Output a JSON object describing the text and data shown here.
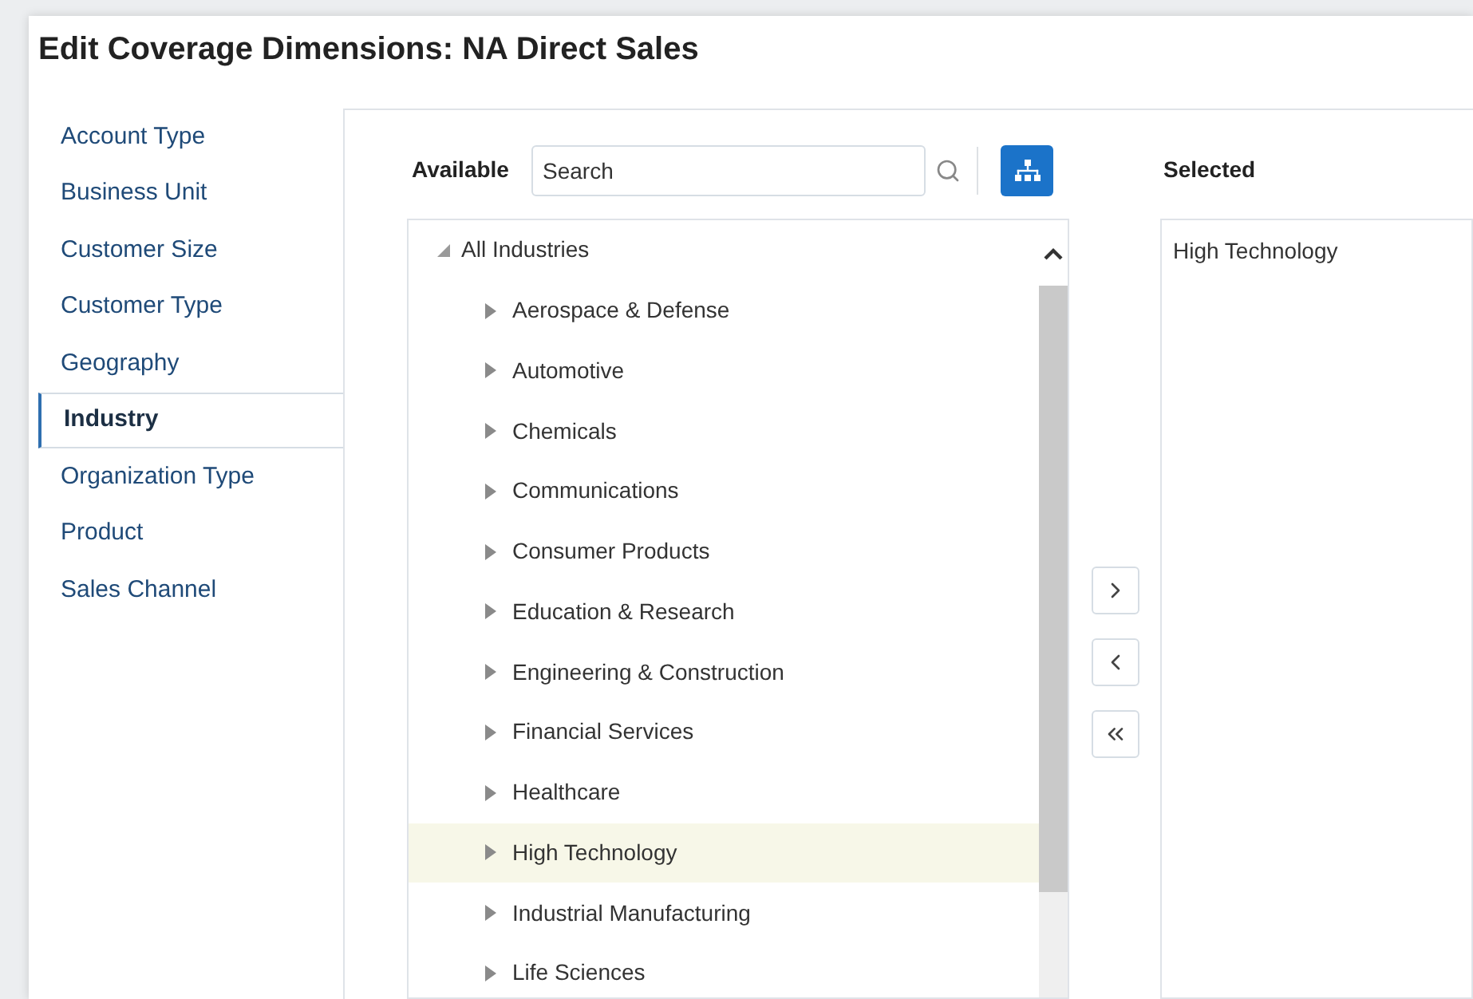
{
  "title": "Edit Coverage Dimensions: NA Direct Sales",
  "sidebar": {
    "items": [
      {
        "label": "Account Type",
        "selected": false
      },
      {
        "label": "Business Unit",
        "selected": false
      },
      {
        "label": "Customer Size",
        "selected": false
      },
      {
        "label": "Customer Type",
        "selected": false
      },
      {
        "label": "Geography",
        "selected": false
      },
      {
        "label": "Industry",
        "selected": true
      },
      {
        "label": "Organization Type",
        "selected": false
      },
      {
        "label": "Product",
        "selected": false
      },
      {
        "label": "Sales Channel",
        "selected": false
      }
    ]
  },
  "available": {
    "label": "Available",
    "search": {
      "placeholder": "Search"
    },
    "tree": [
      {
        "label": "All Industries",
        "expanded": true,
        "selected": false,
        "children": [
          {
            "label": "Aerospace & Defense",
            "expanded": false,
            "selected": false
          },
          {
            "label": "Automotive",
            "expanded": false,
            "selected": false
          },
          {
            "label": "Chemicals",
            "expanded": false,
            "selected": false
          },
          {
            "label": "Communications",
            "expanded": false,
            "selected": false
          },
          {
            "label": "Consumer Products",
            "expanded": false,
            "selected": false
          },
          {
            "label": "Education & Research",
            "expanded": false,
            "selected": false
          },
          {
            "label": "Engineering & Construction",
            "expanded": false,
            "selected": false
          },
          {
            "label": "Financial Services",
            "expanded": false,
            "selected": false
          },
          {
            "label": "Healthcare",
            "expanded": false,
            "selected": false
          },
          {
            "label": "High Technology",
            "expanded": false,
            "selected": true
          },
          {
            "label": "Industrial Manufacturing",
            "expanded": false,
            "selected": false
          },
          {
            "label": "Life Sciences",
            "expanded": false,
            "selected": false
          }
        ]
      }
    ]
  },
  "selected": {
    "label": "Selected",
    "items": [
      "High Technology"
    ]
  }
}
